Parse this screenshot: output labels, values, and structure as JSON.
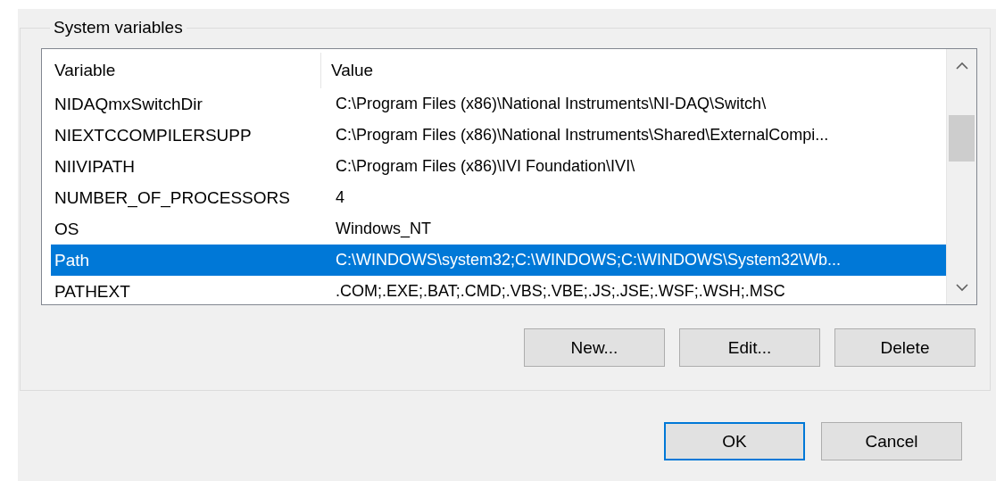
{
  "group": {
    "title": "System variables"
  },
  "table": {
    "columns": [
      "Variable",
      "Value"
    ],
    "rows": [
      {
        "variable": "NIDAQmxSwitchDir",
        "value": "C:\\Program Files (x86)\\National Instruments\\NI-DAQ\\Switch\\",
        "selected": false
      },
      {
        "variable": "NIEXTCCOMPILERSUPP",
        "value": "C:\\Program Files (x86)\\National Instruments\\Shared\\ExternalCompi...",
        "selected": false
      },
      {
        "variable": "NIIVIPATH",
        "value": "C:\\Program Files (x86)\\IVI Foundation\\IVI\\",
        "selected": false
      },
      {
        "variable": "NUMBER_OF_PROCESSORS",
        "value": "4",
        "selected": false
      },
      {
        "variable": "OS",
        "value": "Windows_NT",
        "selected": false
      },
      {
        "variable": "Path",
        "value": "C:\\WINDOWS\\system32;C:\\WINDOWS;C:\\WINDOWS\\System32\\Wb...",
        "selected": true
      },
      {
        "variable": "PATHEXT",
        "value": ".COM;.EXE;.BAT;.CMD;.VBS;.VBE;.JS;.JSE;.WSF;.WSH;.MSC",
        "selected": false
      }
    ]
  },
  "group_buttons": [
    {
      "label": "New...",
      "default": false
    },
    {
      "label": "Edit...",
      "default": false
    },
    {
      "label": "Delete",
      "default": false
    }
  ],
  "dialog_buttons": [
    {
      "label": "OK",
      "default": true
    },
    {
      "label": "Cancel",
      "default": false
    }
  ]
}
